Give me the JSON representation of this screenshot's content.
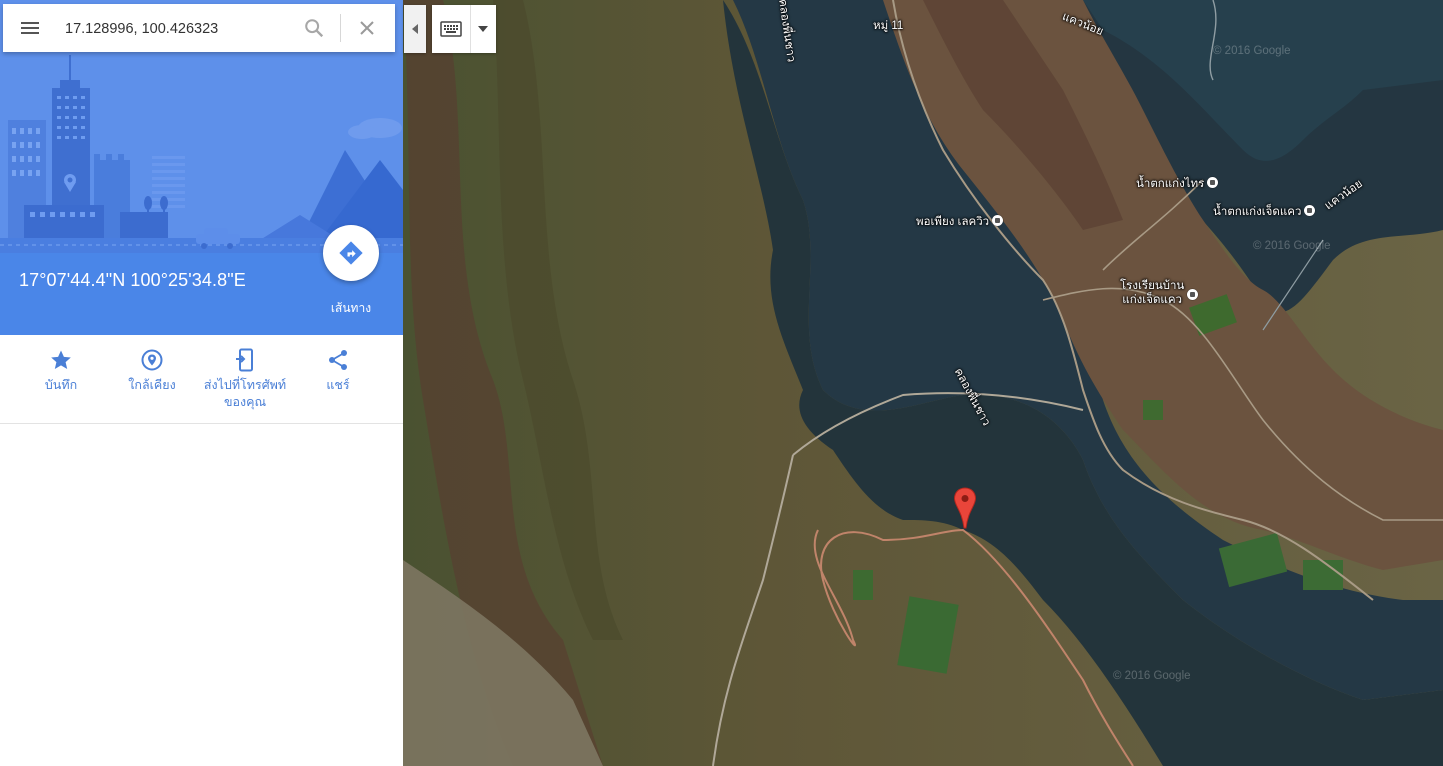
{
  "search": {
    "value": "17.128996, 100.426323",
    "menu_icon": "hamburger-menu-icon",
    "search_icon": "search-icon",
    "clear_icon": "close-icon"
  },
  "place": {
    "coordinates_dms": "17°07'44.4\"N 100°25'34.8\"E",
    "directions_label": "เส้นทาง",
    "directions_icon": "directions-icon"
  },
  "actions": [
    {
      "label": "บันทึก",
      "icon": "star-icon"
    },
    {
      "label": "ใกล้เคียง",
      "icon": "nearby-pin-icon"
    },
    {
      "label": "ส่งไปที่โทรศัพท์",
      "label2": "ของคุณ",
      "icon": "send-to-phone-icon"
    },
    {
      "label": "แชร์",
      "icon": "share-icon"
    }
  ],
  "map": {
    "type": "satellite",
    "labels": {
      "village": "หมู่ 11",
      "stream_top": "คลองพี่นชาว",
      "cove_top_right": "แควน้อย",
      "waterfall1": "น้ำตกแก่งไทร",
      "waterfall2": "น้ำตกแก่งเจ็ดแคว",
      "river_right": "แควน้อย",
      "viewpoint": "พอเพียง เลควิว",
      "school_line1": "โรงเรียนบ้าน",
      "school_line2": "แก่งเจ็ดแคว",
      "stream_mid": "คลองพี่นชาว"
    },
    "watermarks": [
      "© 2016 Google",
      "© 2016 Google",
      "© 2016 Google"
    ],
    "pin_color": "#e9453a"
  },
  "colors": {
    "accent_blue": "#4a86e8",
    "hero_blue": "#5a8de8",
    "action_blue": "#4a7fd6"
  }
}
